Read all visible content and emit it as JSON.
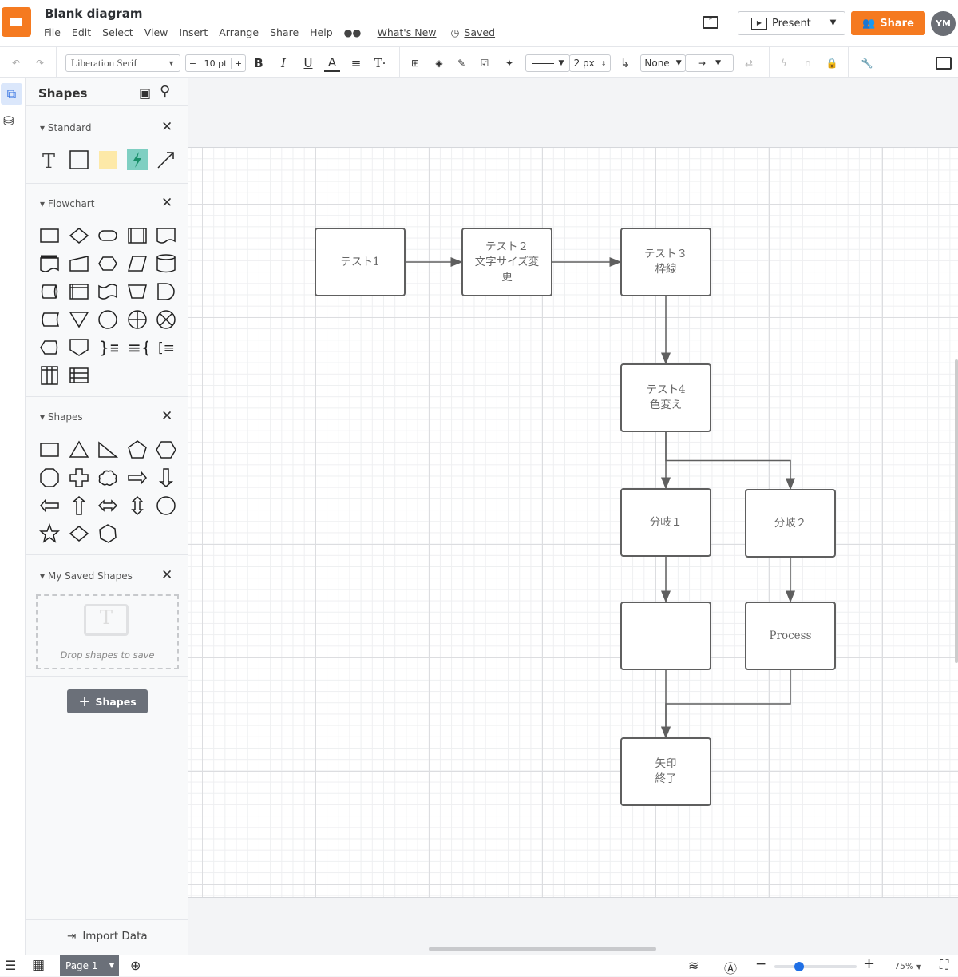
{
  "app": {
    "title": "Blank diagram",
    "menu": [
      "File",
      "Edit",
      "Select",
      "View",
      "Insert",
      "Arrange",
      "Share",
      "Help"
    ],
    "whats_new": "What's New",
    "saved": "Saved",
    "present": "Present",
    "share": "Share",
    "avatar": "YM",
    "brand_color": "#f57a20"
  },
  "toolbar": {
    "font": "Liberation Serif",
    "font_size": "10 pt",
    "minus": "−",
    "plus": "+",
    "bold": "B",
    "italic": "I",
    "underline": "U",
    "font_color": "A",
    "line_width": "2 px",
    "line_end_start": "None"
  },
  "sidebar": {
    "title": "Shapes",
    "sections": [
      {
        "name": "Standard"
      },
      {
        "name": "Flowchart"
      },
      {
        "name": "Shapes"
      },
      {
        "name": "My Saved Shapes"
      }
    ],
    "drop_text": "Drop shapes to save",
    "add_shapes": "Shapes",
    "import": "Import Data"
  },
  "diagram": {
    "nodes": [
      {
        "id": "n1",
        "label": "テスト1"
      },
      {
        "id": "n2",
        "label": "テスト２\n文字サイズ変\n更"
      },
      {
        "id": "n3",
        "label": "テスト３\n枠線"
      },
      {
        "id": "n4",
        "label": "テスト4\n色変え"
      },
      {
        "id": "b1",
        "label": "分岐１"
      },
      {
        "id": "b2",
        "label": "分岐２"
      },
      {
        "id": "b3",
        "label": ""
      },
      {
        "id": "p",
        "label": "Process"
      },
      {
        "id": "end",
        "label": "矢印\n終了"
      }
    ],
    "edges": [
      [
        "n1",
        "n2"
      ],
      [
        "n2",
        "n3"
      ],
      [
        "n3",
        "n4"
      ],
      [
        "n4",
        "b1"
      ],
      [
        "n4",
        "b2"
      ],
      [
        "b1",
        "b3"
      ],
      [
        "b2",
        "p"
      ],
      [
        "b3",
        "end"
      ],
      [
        "p",
        "end"
      ]
    ]
  },
  "bottom": {
    "page": "Page 1",
    "zoom": "75%",
    "zoom_level": 0.3
  }
}
